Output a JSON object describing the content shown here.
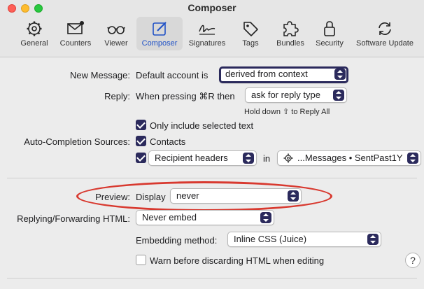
{
  "window": {
    "title": "Composer"
  },
  "toolbar": {
    "items": [
      {
        "label": "General",
        "icon": "gear-icon"
      },
      {
        "label": "Counters",
        "icon": "envelope-badge-icon"
      },
      {
        "label": "Viewer",
        "icon": "glasses-icon"
      },
      {
        "label": "Composer",
        "icon": "compose-icon",
        "active": true
      },
      {
        "label": "Signatures",
        "icon": "signature-icon"
      },
      {
        "label": "Tags",
        "icon": "tag-icon"
      },
      {
        "label": "Bundles",
        "icon": "puzzle-icon"
      },
      {
        "label": "Security",
        "icon": "lock-icon"
      },
      {
        "label": "Software Update",
        "icon": "refresh-icon"
      }
    ]
  },
  "new_message": {
    "label": "New Message:",
    "prefix": "Default account is",
    "value": "derived from context"
  },
  "reply": {
    "label": "Reply:",
    "prefix": "When pressing ⌘R then",
    "value": "ask for reply type",
    "hint": "Hold down ⇧ to Reply All"
  },
  "only_selected": {
    "label": "Only include selected text",
    "checked": true
  },
  "autocomplete": {
    "label": "Auto-Completion Sources:",
    "contacts": {
      "label": "Contacts",
      "checked": true
    },
    "recipient": {
      "checked": true,
      "value": "Recipient headers"
    },
    "in_label": "in",
    "mailbox": "...Messages • SentPast1Y"
  },
  "preview": {
    "label": "Preview:",
    "prefix": "Display",
    "value": "never"
  },
  "html": {
    "label": "Replying/Forwarding HTML:",
    "value": "Never embed",
    "embed_label": "Embedding method:",
    "embed_value": "Inline CSS (Juice)",
    "warn": {
      "label": "Warn before discarding HTML when editing",
      "checked": false
    }
  },
  "help": {
    "label": "?"
  },
  "colors": {
    "accent": "#2b2a5c",
    "highlight": "#d8392f",
    "active_tab": "#1f51c6"
  }
}
